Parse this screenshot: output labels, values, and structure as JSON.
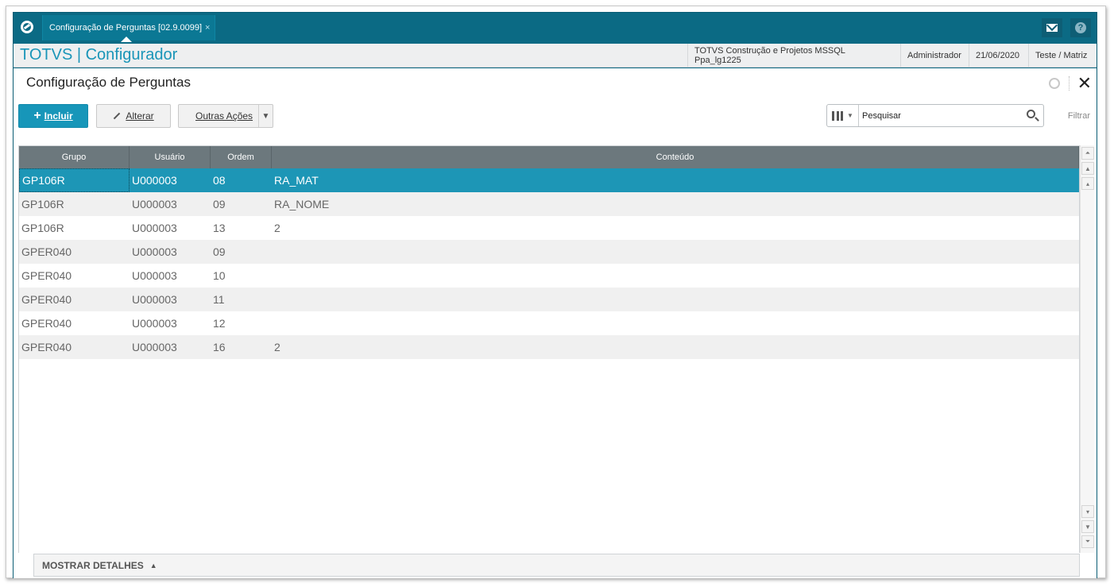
{
  "topbar": {
    "tab_label": "Configuração de Perguntas [02.9.0099]",
    "tab_close": "×",
    "help_glyph": "?"
  },
  "header": {
    "brand": "TOTVS | Configurador",
    "company": "TOTVS Construção e Projetos MSSQL Ppa_lg1225",
    "user": "Administrador",
    "date": "21/06/2020",
    "branch": "Teste / Matriz"
  },
  "page": {
    "title": "Configuração de Perguntas",
    "close_glyph": "✕"
  },
  "toolbar": {
    "incluir": "Incluir",
    "alterar": "Alterar",
    "outras_acoes": "Outras Ações"
  },
  "search": {
    "placeholder": "Pesquisar",
    "filter_label": "Filtrar"
  },
  "grid": {
    "columns": [
      "Grupo",
      "Usuário",
      "Ordem",
      "Conteúdo"
    ],
    "rows": [
      {
        "grupo": "GP106R",
        "usuario": "U000003",
        "ordem": "08",
        "conteudo": "RA_MAT"
      },
      {
        "grupo": "GP106R",
        "usuario": "U000003",
        "ordem": "09",
        "conteudo": "RA_NOME"
      },
      {
        "grupo": "GP106R",
        "usuario": "U000003",
        "ordem": "13",
        "conteudo": "2"
      },
      {
        "grupo": "GPER040",
        "usuario": "U000003",
        "ordem": "09",
        "conteudo": ""
      },
      {
        "grupo": "GPER040",
        "usuario": "U000003",
        "ordem": "10",
        "conteudo": ""
      },
      {
        "grupo": "GPER040",
        "usuario": "U000003",
        "ordem": "11",
        "conteudo": ""
      },
      {
        "grupo": "GPER040",
        "usuario": "U000003",
        "ordem": "12",
        "conteudo": ""
      },
      {
        "grupo": "GPER040",
        "usuario": "U000003",
        "ordem": "16",
        "conteudo": "2"
      }
    ],
    "selected_row": 0
  },
  "details": {
    "label": "MOSTRAR DETALHES"
  },
  "colors": {
    "brand_teal": "#0b6a84",
    "accent_blue": "#1796b9",
    "selected_row": "#1d96b6",
    "grid_header": "#6c787d"
  },
  "icons": [
    "totvs-logo-icon",
    "mail-icon",
    "help-icon",
    "gear-icon",
    "close-icon",
    "plus-icon",
    "pencil-icon",
    "chevron-down-icon",
    "columns-icon",
    "search-icon",
    "scroll-top-icon",
    "scroll-page-up-icon",
    "scroll-up-icon",
    "scroll-down-icon",
    "scroll-page-down-icon",
    "scroll-bottom-icon",
    "triangle-up-icon"
  ]
}
